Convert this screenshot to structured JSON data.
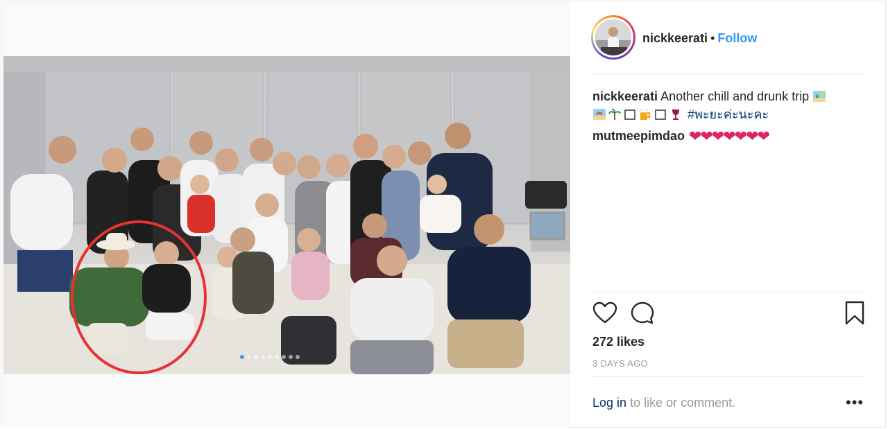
{
  "post": {
    "photo": {
      "carousel_dot_count": 9,
      "carousel_active_index": 0,
      "highlight_color": "#e83232"
    },
    "header": {
      "username": "nickkeerati",
      "separator": "•",
      "follow_label": "Follow"
    },
    "caption": {
      "username": "nickkeerati",
      "text": "Another chill and drunk trip",
      "hashtag": "#พะยะค่ะนะคะ"
    },
    "comment": {
      "username": "mutmeepimdao",
      "hearts": "❤❤❤❤❤❤❤"
    },
    "likes": "272 likes",
    "timestamp": "3 DAYS AGO",
    "footer": {
      "login_link": "Log in",
      "login_text": "to like or comment.",
      "more_label": "•••"
    },
    "colors": {
      "link_blue": "#3897f0",
      "hashtag_navy": "#003569",
      "muted_gray": "#999999"
    }
  }
}
